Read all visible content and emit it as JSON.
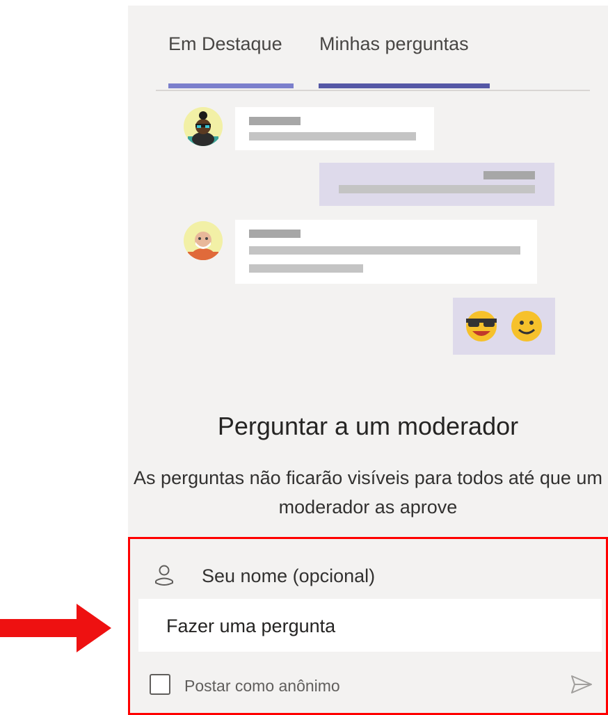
{
  "tabs": [
    {
      "label": "Em Destaque",
      "indicator_color": "#7b7fcc"
    },
    {
      "label": "Minhas perguntas",
      "indicator_color": "#5558a6"
    }
  ],
  "empty_state": {
    "heading": "Perguntar a um moderador",
    "description": "As perguntas não ficarão visíveis para todos até que um moderador as aprove"
  },
  "compose": {
    "name_placeholder": "Seu nome (opcional)",
    "question_placeholder": "Fazer uma pergunta",
    "anonymous_label": "Postar como anônimo",
    "anonymous_checked": false
  },
  "icons": {
    "name": "person-icon",
    "send": "send-icon",
    "emoji_1": "sunglasses-emoji-icon",
    "emoji_2": "smile-emoji-icon",
    "annotation": "red-arrow-pointer"
  },
  "colors": {
    "highlight_border": "#ff0000",
    "panel_bg": "#f3f2f1",
    "my_bubble_bg": "#dedaeb"
  }
}
